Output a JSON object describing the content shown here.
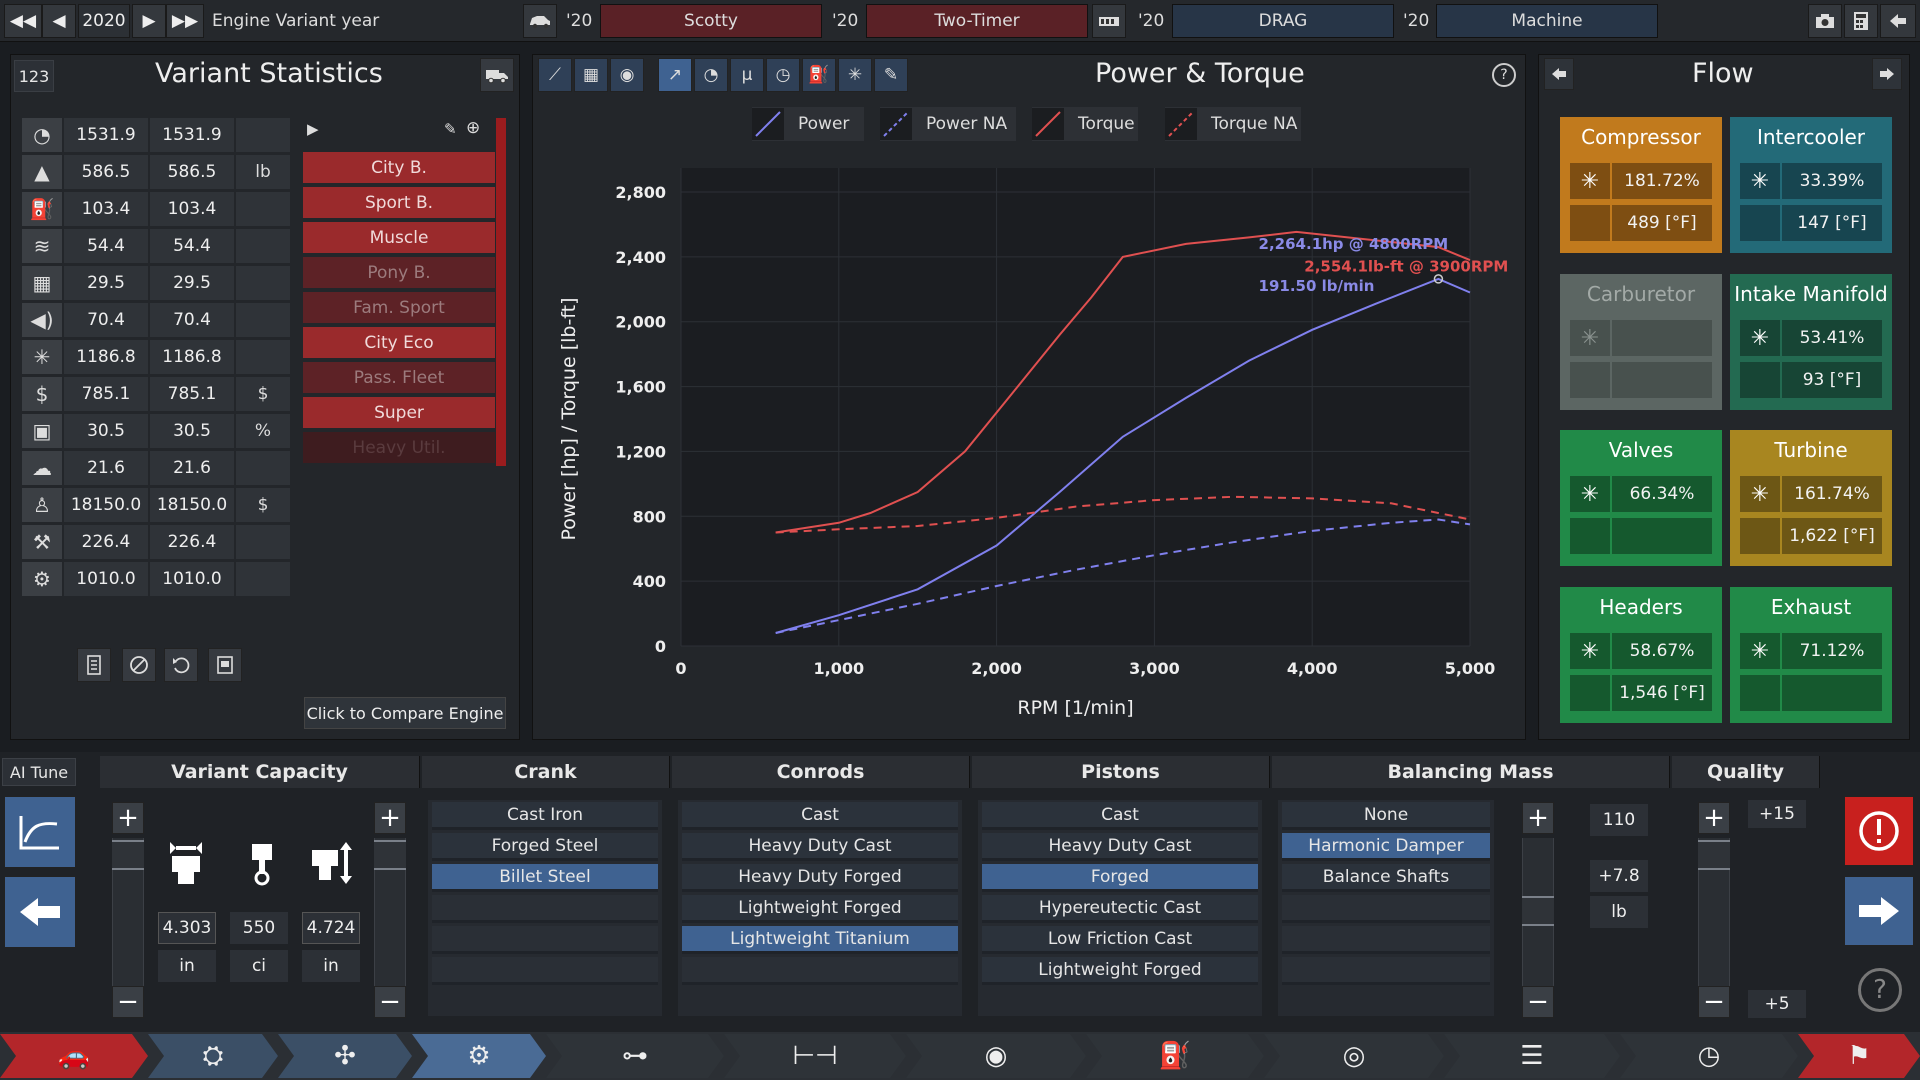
{
  "topbar": {
    "year_prev_fast": "◀◀",
    "year_prev": "◀",
    "year": "2020",
    "year_next": "▶",
    "year_next_fast": "▶▶",
    "year_label": "Engine Variant year",
    "car_icon": "car-icon",
    "models": [
      {
        "year": "'20",
        "name": "Scotty",
        "color": "#5a2126"
      },
      {
        "year": "'20",
        "name": "Two-Timer",
        "color": "#5a2126"
      },
      {
        "year": "'20",
        "name": "DRAG",
        "color": "#273547"
      },
      {
        "year": "'20",
        "name": "Machine",
        "color": "#273547"
      }
    ]
  },
  "stats": {
    "title": "Variant Statistics",
    "badge": "123",
    "rows": [
      {
        "icon": "gauge-icon",
        "v1": "1531.9",
        "v2": "1531.9",
        "unit": ""
      },
      {
        "icon": "weight-icon",
        "v1": "586.5",
        "v2": "586.5",
        "unit": "lb"
      },
      {
        "icon": "fuel-icon",
        "v1": "103.4",
        "v2": "103.4",
        "unit": ""
      },
      {
        "icon": "smooth-icon",
        "v1": "54.4",
        "v2": "54.4",
        "unit": ""
      },
      {
        "icon": "radiator-icon",
        "v1": "29.5",
        "v2": "29.5",
        "unit": ""
      },
      {
        "icon": "sound-icon",
        "v1": "70.4",
        "v2": "70.4",
        "unit": ""
      },
      {
        "icon": "snowflake-icon",
        "v1": "1186.8",
        "v2": "1186.8",
        "unit": ""
      },
      {
        "icon": "cost-icon",
        "v1": "785.1",
        "v2": "785.1",
        "unit": "$"
      },
      {
        "icon": "fuel-can-icon",
        "v1": "30.5",
        "v2": "30.5",
        "unit": "%"
      },
      {
        "icon": "emissions-icon",
        "v1": "21.6",
        "v2": "21.6",
        "unit": ""
      },
      {
        "icon": "person-cost-icon",
        "v1": "18150.0",
        "v2": "18150.0",
        "unit": "$"
      },
      {
        "icon": "service-icon",
        "v1": "226.4",
        "v2": "226.4",
        "unit": ""
      },
      {
        "icon": "gear-icon",
        "v1": "1010.0",
        "v2": "1010.0",
        "unit": ""
      }
    ],
    "markets": [
      {
        "label": "City B.",
        "active": true
      },
      {
        "label": "Sport B.",
        "active": true
      },
      {
        "label": "Muscle",
        "active": true
      },
      {
        "label": "Pony B.",
        "active": false
      },
      {
        "label": "Fam. Sport",
        "active": false
      },
      {
        "label": "City Eco",
        "active": true
      },
      {
        "label": "Pass. Fleet",
        "active": false
      },
      {
        "label": "Super",
        "active": true
      },
      {
        "label": "Heavy Util.",
        "active": false,
        "dim": true
      }
    ],
    "compare_button": "Click to Compare Engine"
  },
  "chart_panel": {
    "title": "Power & Torque",
    "help": "?",
    "legend": [
      {
        "label": "Power",
        "color": "#8080ee",
        "dashed": false
      },
      {
        "label": "Power NA",
        "color": "#8080ee",
        "dashed": true
      },
      {
        "label": "Torque",
        "color": "#e05050",
        "dashed": false
      },
      {
        "label": "Torque NA",
        "color": "#e05050",
        "dashed": true
      }
    ],
    "tooltip_power": "2,264.1hp @ 4800RPM",
    "tooltip_power2": "191.50 lb/min",
    "tooltip_torque": "2,554.1lb-ft @ 3900RPM"
  },
  "chart_data": {
    "type": "line",
    "xlabel": "RPM [1/min]",
    "ylabel": "Power [hp] / Torque [lb-ft]",
    "xlim": [
      0,
      5000
    ],
    "ylim": [
      0,
      2800
    ],
    "xticks": [
      "0",
      "1,000",
      "2,000",
      "3,000",
      "4,000",
      "5,000"
    ],
    "yticks": [
      "0",
      "400",
      "800",
      "1,200",
      "1,600",
      "2,000",
      "2,400",
      "2,800"
    ],
    "series": [
      {
        "name": "Power",
        "color": "#8080ee",
        "dashed": false,
        "x": [
          600,
          1000,
          1500,
          2000,
          2400,
          2800,
          3200,
          3600,
          4000,
          4400,
          4800,
          5000
        ],
        "y": [
          80,
          190,
          350,
          620,
          950,
          1290,
          1530,
          1760,
          1950,
          2110,
          2264,
          2180
        ]
      },
      {
        "name": "Power NA",
        "color": "#8080ee",
        "dashed": true,
        "x": [
          600,
          1000,
          1500,
          2000,
          2500,
          3000,
          3500,
          4000,
          4500,
          4800,
          5000
        ],
        "y": [
          80,
          160,
          260,
          370,
          470,
          560,
          640,
          710,
          760,
          780,
          750
        ]
      },
      {
        "name": "Torque",
        "color": "#e05050",
        "dashed": false,
        "x": [
          600,
          1000,
          1200,
          1500,
          1800,
          2100,
          2400,
          2600,
          2800,
          3200,
          3600,
          3900,
          4800,
          5000
        ],
        "y": [
          700,
          760,
          820,
          950,
          1200,
          1560,
          1920,
          2150,
          2400,
          2480,
          2520,
          2554,
          2460,
          2380
        ]
      },
      {
        "name": "Torque NA",
        "color": "#e05050",
        "dashed": true,
        "x": [
          600,
          1000,
          1500,
          2000,
          2500,
          3000,
          3500,
          4000,
          4500,
          5000
        ],
        "y": [
          700,
          720,
          740,
          790,
          860,
          900,
          920,
          910,
          880,
          780
        ]
      }
    ]
  },
  "flow": {
    "title": "Flow",
    "boxes": [
      {
        "name": "Compressor",
        "pct": "181.72%",
        "temp": "489 [°F]",
        "color": "#c17a1d",
        "dark": "#7e4e12"
      },
      {
        "name": "Intercooler",
        "pct": "33.39%",
        "temp": "147 [°F]",
        "color": "#236a78",
        "dark": "#174550"
      },
      {
        "name": "Carburetor",
        "pct": "",
        "temp": "",
        "color": "#5c6663",
        "dark": "#48514e",
        "disabled": true
      },
      {
        "name": "Intake Manifold",
        "pct": "53.41%",
        "temp": "93 [°F]",
        "color": "#236a51",
        "dark": "#174535"
      },
      {
        "name": "Valves",
        "pct": "66.34%",
        "temp": "",
        "color": "#218a48",
        "dark": "#15592e"
      },
      {
        "name": "Turbine",
        "pct": "161.74%",
        "temp": "1,622 [°F]",
        "color": "#a88620",
        "dark": "#6d5715"
      },
      {
        "name": "Headers",
        "pct": "58.67%",
        "temp": "1,546 [°F]",
        "color": "#218a48",
        "dark": "#15592e"
      },
      {
        "name": "Exhaust",
        "pct": "71.12%",
        "temp": "",
        "color": "#218a48",
        "dark": "#15592e"
      }
    ]
  },
  "bottom": {
    "ai_tune": "AI Tune",
    "capacity": {
      "title": "Variant Capacity",
      "bore": "4.303",
      "bore_unit": "in",
      "disp": "550",
      "disp_unit": "ci",
      "stroke": "4.724",
      "stroke_unit": "in"
    },
    "crank": {
      "title": "Crank",
      "options": [
        "Cast Iron",
        "Forged Steel",
        "Billet Steel"
      ],
      "selected": 2
    },
    "conrods": {
      "title": "Conrods",
      "options": [
        "Cast",
        "Heavy Duty Cast",
        "Heavy Duty Forged",
        "Lightweight Forged",
        "Lightweight Titanium"
      ],
      "selected": 4
    },
    "pistons": {
      "title": "Pistons",
      "options": [
        "Cast",
        "Heavy Duty Cast",
        "Forged",
        "Hypereutectic Cast",
        "Low Friction Cast",
        "Lightweight Forged"
      ],
      "selected": 2
    },
    "balancing": {
      "title": "Balancing Mass",
      "options": [
        "None",
        "Harmonic Damper",
        "Balance Shafts"
      ],
      "selected": 1,
      "value": "110",
      "delta": "+7.8",
      "unit": "lb"
    },
    "quality": {
      "title": "Quality",
      "top": "+15",
      "bottom": "+5"
    }
  },
  "navbar": {
    "items": [
      "car-body-icon",
      "chassis-icon",
      "engine-family-icon",
      "engine-variant-icon",
      "top-end-icon",
      "aspiration-icon",
      "turbo-icon",
      "fuel-system-icon",
      "exhaust-icon",
      "gearbox-icon",
      "test-track-icon",
      "car-model-icon"
    ]
  }
}
